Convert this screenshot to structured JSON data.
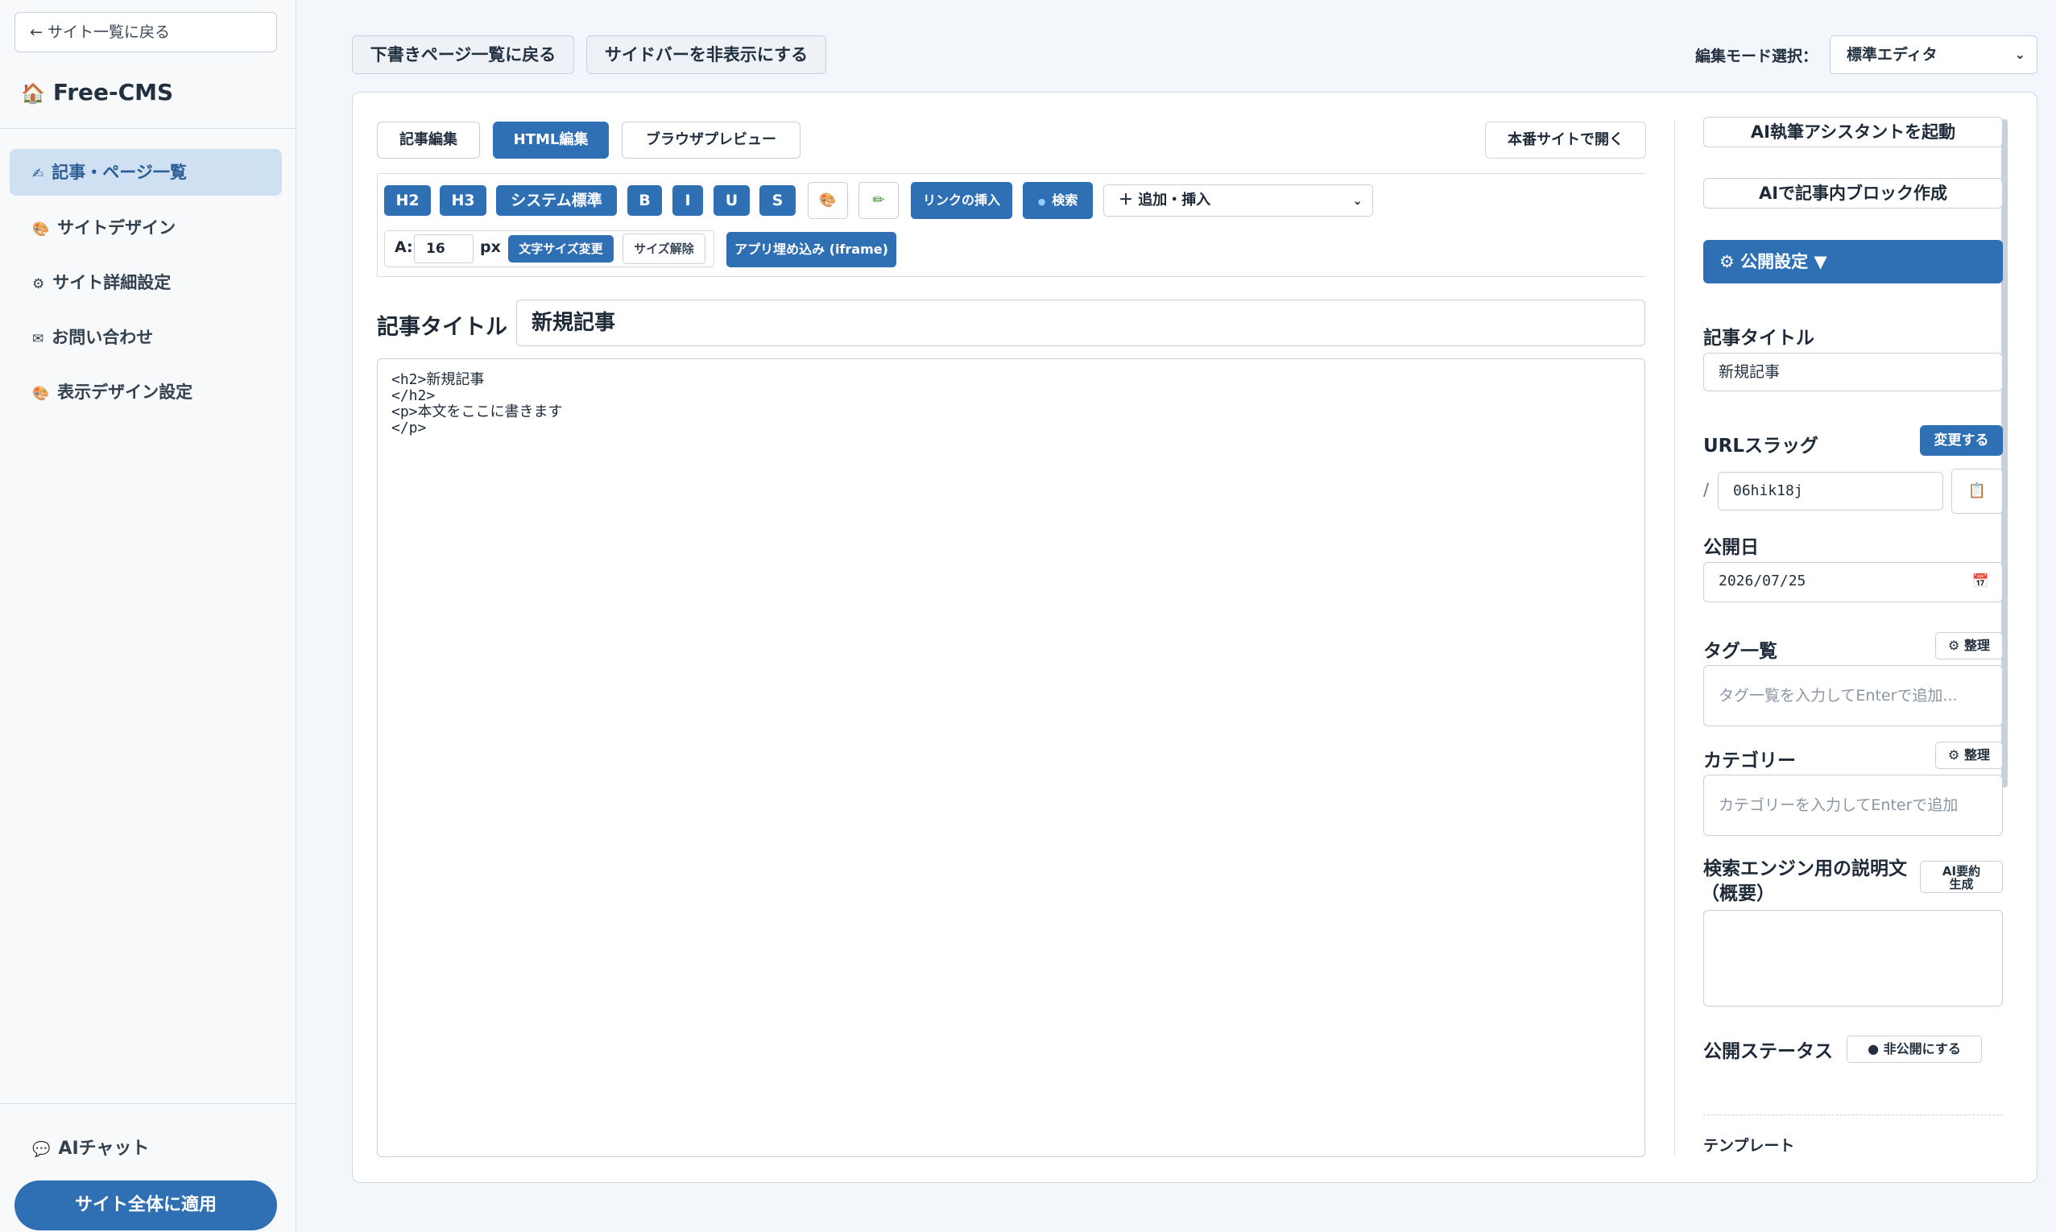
{
  "sidebar": {
    "back_label": "← サイト一覧に戻る",
    "brand": "Free-CMS",
    "brand_icon": "🏠",
    "items": [
      {
        "label": "記事・ページ一覧",
        "icon": "✍"
      },
      {
        "label": "サイトデザイン",
        "icon": "🎨"
      },
      {
        "label": "サイト詳細設定",
        "icon": "⚙"
      },
      {
        "label": "お問い合わせ",
        "icon": "✉"
      },
      {
        "label": "表示デザイン設定",
        "icon": "🎨"
      }
    ],
    "ai_chat": "AIチャット",
    "ai_chat_icon": "💬",
    "apply": "サイト全体に適用"
  },
  "topbar": {
    "back_drafts": "下書きページ一覧に戻る",
    "hide_sidebar": "サイドバーを非表示にする",
    "mode_label": "編集モード選択：",
    "mode_value": "標準エディタ"
  },
  "editor": {
    "tabs": [
      "記事編集",
      "HTML編集",
      "ブラウザプレビュー"
    ],
    "open_site": "本番サイトで開く",
    "toolbar": {
      "h2": "H2",
      "h3": "H3",
      "system": "システム標準",
      "bold": "B",
      "italic": "I",
      "underline": "U",
      "strike": "S",
      "palette_icon": "🎨",
      "pencil_icon": "✏",
      "insert_link": "リンクの挿入",
      "search": "検索",
      "search_icon": "●",
      "add_insert": "＋ 追加・挿入",
      "fs_label": "A:",
      "fs_value": "16",
      "fs_unit": "px",
      "fs_change": "文字サイズ変更",
      "fs_reset": "サイズ解除",
      "iframe": "アプリ埋め込み (iframe)"
    },
    "title_label": "記事タイトル",
    "title_value": "新規記事",
    "code_lines": [
      "<h2>新規記事",
      "</h2>",
      "<p>本文をここに書きます",
      "</p>"
    ]
  },
  "settings": {
    "ai_assistant": "AI執筆アシスタントを起動",
    "ai_block": "AIで記事内ブロック作成",
    "publish_settings": "⚙ 公開設定 ▼",
    "title_label": "記事タイトル",
    "title_value": "新規記事",
    "slug_label": "URLスラッグ",
    "slug_change": "変更する",
    "slug_prefix": "/",
    "slug_value": "06hik18j",
    "copy_icon": "📋",
    "date_label": "公開日",
    "date_value": "2026/07/25",
    "calendar_icon": "📅",
    "tags_label": "タグ一覧",
    "tags_manage": "⚙ 整理",
    "tags_placeholder": "タグ一覧を入力してEnterで追加...",
    "category_label": "カテゴリー",
    "category_manage": "⚙ 整理",
    "category_placeholder": "カテゴリーを入力してEnterで追加",
    "seo_label_1": "検索エンジン用の説明文",
    "seo_label_2": "（概要）",
    "ai_summary_1": "AI要約",
    "ai_summary_2": "生成",
    "status_label": "公開ステータス",
    "status_value": "● 非公開にする",
    "template_label": "テンプレート"
  },
  "colors": {
    "accent": "#2f70b5",
    "active_nav_bg": "#cfe0f2"
  }
}
